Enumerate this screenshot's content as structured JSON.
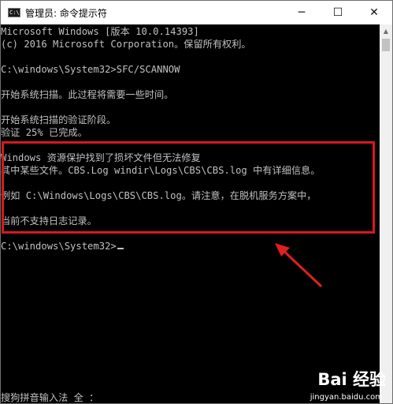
{
  "window": {
    "title": "管理员: 命令提示符",
    "icon_text": "C:\\",
    "controls": {
      "minimize": "─",
      "maximize": "☐",
      "close": "✕"
    }
  },
  "console": {
    "lines": [
      "Microsoft Windows [版本 10.0.14393]",
      "(c) 2016 Microsoft Corporation。保留所有权利。",
      "",
      "C:\\windows\\System32>SFC/SCANNOW",
      "",
      "开始系统扫描。此过程将需要一些时间。",
      "",
      "开始系统扫描的验证阶段。",
      "验证 25% 已完成。",
      "",
      "Windows 资源保护找到了损坏文件但无法修复",
      "其中某些文件。CBS.Log windir\\Logs\\CBS\\CBS.log 中有详细信息。",
      "例如 C:\\Windows\\Logs\\CBS\\CBS.log。请注意，在脱机服务方案中，",
      "当前不支持日志记录。",
      "",
      "C:\\windows\\System32>"
    ],
    "scan_progress_percent": 25
  },
  "ime_status": "搜狗拼音输入法 全 ：",
  "annotation": {
    "highlight_color": "#d8191c"
  },
  "watermark": {
    "logo": "Bai 经验",
    "url": "jingyan.baidu.com"
  }
}
